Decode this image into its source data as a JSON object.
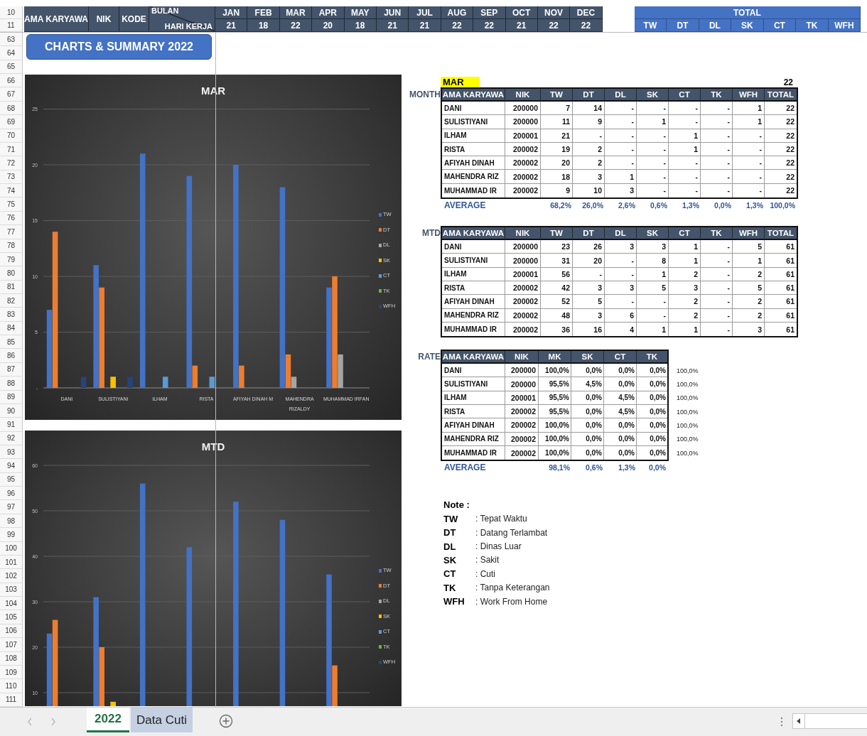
{
  "header": {
    "row_numbers": [
      "10",
      "11"
    ],
    "name_heading": "AMA KARYAWA",
    "nik_heading": "NIK",
    "kode_heading": "KODE",
    "month_heading": "BULAN",
    "workdays_heading": "HARI KERJA",
    "months": [
      {
        "name": "JAN",
        "workdays": "21"
      },
      {
        "name": "FEB",
        "workdays": "18"
      },
      {
        "name": "MAR",
        "workdays": "22"
      },
      {
        "name": "APR",
        "workdays": "20"
      },
      {
        "name": "MAY",
        "workdays": "18"
      },
      {
        "name": "JUN",
        "workdays": "21"
      },
      {
        "name": "JUL",
        "workdays": "21"
      },
      {
        "name": "AUG",
        "workdays": "22"
      },
      {
        "name": "SEP",
        "workdays": "22"
      },
      {
        "name": "OCT",
        "workdays": "21"
      },
      {
        "name": "NOV",
        "workdays": "22"
      },
      {
        "name": "DEC",
        "workdays": "22"
      }
    ],
    "total_heading": "TOTAL",
    "total_columns": [
      "TW",
      "DT",
      "DL",
      "SK",
      "CT",
      "TK",
      "WFH"
    ]
  },
  "row_numbers": [
    "63",
    "64",
    "65",
    "66",
    "67",
    "68",
    "69",
    "70",
    "71",
    "72",
    "73",
    "74",
    "75",
    "76",
    "77",
    "78",
    "79",
    "80",
    "81",
    "82",
    "83",
    "84",
    "85",
    "86",
    "87",
    "88",
    "89",
    "90",
    "91",
    "92",
    "93",
    "94",
    "95",
    "96",
    "97",
    "98",
    "99",
    "100",
    "101",
    "102",
    "103",
    "104",
    "105",
    "106",
    "107",
    "108",
    "109",
    "110",
    "111"
  ],
  "title_button": "CHARTS & SUMMARY 2022",
  "charts": [
    {
      "chart_data": {
        "type": "bar",
        "title": "MAR",
        "grid": true,
        "legend": true,
        "categories": [
          "DANI",
          "SULISTIYANI",
          "ILHAM",
          "RISTA",
          "AFIYAH DINAH M",
          "MAHENDRA RIZALDY",
          "MUHAMMAD IRFAN"
        ],
        "ylim": [
          0,
          25
        ],
        "yticks": [
          {
            "value": 0,
            "label": "-"
          },
          5,
          10,
          15,
          20,
          25
        ],
        "series": [
          {
            "name": "TW",
            "color": "#4472c4",
            "values": [
              7,
              11,
              21,
              19,
              20,
              18,
              9
            ]
          },
          {
            "name": "DT",
            "color": "#ed7d31",
            "values": [
              14,
              9,
              0,
              2,
              2,
              3,
              10
            ]
          },
          {
            "name": "DL",
            "color": "#a5a5a5",
            "values": [
              0,
              0,
              0,
              0,
              0,
              1,
              3
            ]
          },
          {
            "name": "SK",
            "color": "#ffc000",
            "values": [
              0,
              1,
              0,
              0,
              0,
              0,
              0
            ]
          },
          {
            "name": "CT",
            "color": "#5b9bd5",
            "values": [
              0,
              0,
              1,
              1,
              0,
              0,
              0
            ]
          },
          {
            "name": "TK",
            "color": "#70ad47",
            "values": [
              0,
              0,
              0,
              0,
              0,
              0,
              0
            ]
          },
          {
            "name": "WFH",
            "color": "#264478",
            "values": [
              1,
              1,
              0,
              0,
              0,
              0,
              0
            ]
          }
        ]
      }
    },
    {
      "chart_data": {
        "type": "bar",
        "title": "MTD",
        "grid": true,
        "legend": true,
        "ylim": [
          0,
          60
        ],
        "yticks": [
          10,
          20,
          30,
          40,
          50,
          60
        ],
        "series": [
          {
            "name": "TW",
            "color": "#4472c4",
            "values": [
              23,
              31,
              56,
              42,
              52,
              48,
              36
            ]
          },
          {
            "name": "DT",
            "color": "#ed7d31",
            "values": [
              26,
              20,
              null,
              null,
              null,
              null,
              16
            ]
          },
          {
            "name": "DL",
            "color": "#a5a5a5",
            "values": [
              null,
              null,
              null,
              null,
              null,
              null,
              null
            ]
          },
          {
            "name": "SK",
            "color": "#ffc000",
            "values": [
              null,
              8,
              null,
              null,
              null,
              null,
              null
            ]
          },
          {
            "name": "CT",
            "color": "#5b9bd5",
            "values": [
              null,
              null,
              null,
              null,
              null,
              null,
              null
            ]
          },
          {
            "name": "TK",
            "color": "#70ad47",
            "values": [
              null,
              null,
              null,
              null,
              null,
              null,
              null
            ]
          },
          {
            "name": "WFH",
            "color": "#264478",
            "values": [
              null,
              null,
              null,
              null,
              null,
              null,
              null
            ]
          }
        ]
      }
    }
  ],
  "month_table": {
    "month": "MAR",
    "workdays": "22",
    "label": "MONTH",
    "columns": [
      "AMA KARYAWA",
      "NIK",
      "TW",
      "DT",
      "DL",
      "SK",
      "CT",
      "TK",
      "WFH",
      "TOTAL"
    ],
    "rows": [
      {
        "cells": [
          "DANI",
          "200000",
          "7",
          "14",
          "-",
          "-",
          "-",
          "-",
          "1",
          "22"
        ]
      },
      {
        "cells": [
          "SULISTIYANI",
          "200000",
          "11",
          "9",
          "-",
          "1",
          "-",
          "-",
          "1",
          "22"
        ]
      },
      {
        "cells": [
          "ILHAM",
          "200001",
          "21",
          "-",
          "-",
          "-",
          "1",
          "-",
          "-",
          "22"
        ]
      },
      {
        "cells": [
          "RISTA",
          "200002",
          "19",
          "2",
          "-",
          "-",
          "1",
          "-",
          "-",
          "22"
        ]
      },
      {
        "cells": [
          "AFIYAH DINAH",
          "200002",
          "20",
          "2",
          "-",
          "-",
          "-",
          "-",
          "-",
          "22"
        ]
      },
      {
        "cells": [
          "MAHENDRA RIZ",
          "200002",
          "18",
          "3",
          "1",
          "-",
          "-",
          "-",
          "-",
          "22"
        ]
      },
      {
        "cells": [
          "MUHAMMAD IR",
          "200002",
          "9",
          "10",
          "3",
          "-",
          "-",
          "-",
          "-",
          "22"
        ]
      }
    ],
    "average": {
      "label": "AVERAGE",
      "values": [
        "68,2%",
        "26,0%",
        "2,6%",
        "0,6%",
        "1,3%",
        "0,0%",
        "1,3%",
        "100,0%"
      ]
    }
  },
  "mtd_table": {
    "label": "MTD",
    "columns": [
      "AMA KARYAWA",
      "NIK",
      "TW",
      "DT",
      "DL",
      "SK",
      "CT",
      "TK",
      "WFH",
      "TOTAL"
    ],
    "rows": [
      {
        "cells": [
          "DANI",
          "200000",
          "23",
          "26",
          "3",
          "3",
          "1",
          "-",
          "5",
          "61"
        ]
      },
      {
        "cells": [
          "SULISTIYANI",
          "200000",
          "31",
          "20",
          "-",
          "8",
          "1",
          "-",
          "1",
          "61"
        ]
      },
      {
        "cells": [
          "ILHAM",
          "200001",
          "56",
          "-",
          "-",
          "1",
          "2",
          "-",
          "2",
          "61"
        ]
      },
      {
        "cells": [
          "RISTA",
          "200002",
          "42",
          "3",
          "3",
          "5",
          "3",
          "-",
          "5",
          "61"
        ]
      },
      {
        "cells": [
          "AFIYAH DINAH",
          "200002",
          "52",
          "5",
          "-",
          "-",
          "2",
          "-",
          "2",
          "61"
        ]
      },
      {
        "cells": [
          "MAHENDRA RIZ",
          "200002",
          "48",
          "3",
          "6",
          "-",
          "2",
          "-",
          "2",
          "61"
        ]
      },
      {
        "cells": [
          "MUHAMMAD IR",
          "200002",
          "36",
          "16",
          "4",
          "1",
          "1",
          "-",
          "3",
          "61"
        ]
      }
    ]
  },
  "rate_table": {
    "label": "RATE",
    "columns": [
      "AMA KARYAWA",
      "NIK",
      "MK",
      "SK",
      "CT",
      "TK"
    ],
    "rows": [
      {
        "cells": [
          "DANI",
          "200000",
          "100,0%",
          "0,0%",
          "0,0%",
          "0,0%"
        ],
        "total": "100,0%"
      },
      {
        "cells": [
          "SULISTIYANI",
          "200000",
          "95,5%",
          "4,5%",
          "0,0%",
          "0,0%"
        ],
        "total": "100,0%"
      },
      {
        "cells": [
          "ILHAM",
          "200001",
          "95,5%",
          "0,0%",
          "4,5%",
          "0,0%"
        ],
        "total": "100,0%"
      },
      {
        "cells": [
          "RISTA",
          "200002",
          "95,5%",
          "0,0%",
          "4,5%",
          "0,0%"
        ],
        "total": "100,0%"
      },
      {
        "cells": [
          "AFIYAH DINAH",
          "200002",
          "100,0%",
          "0,0%",
          "0,0%",
          "0,0%"
        ],
        "total": "100,0%"
      },
      {
        "cells": [
          "MAHENDRA RIZ",
          "200002",
          "100,0%",
          "0,0%",
          "0,0%",
          "0,0%"
        ],
        "total": "100,0%"
      },
      {
        "cells": [
          "MUHAMMAD IR",
          "200002",
          "100,0%",
          "0,0%",
          "0,0%",
          "0,0%"
        ],
        "total": "100,0%"
      }
    ],
    "average": {
      "label": "AVERAGE",
      "values": [
        "98,1%",
        "0,6%",
        "1,3%",
        "0,0%"
      ]
    }
  },
  "notes": {
    "title": "Note :",
    "items": [
      {
        "code": "TW",
        "meaning": ": Tepat Waktu"
      },
      {
        "code": "DT",
        "meaning": ": Datang Terlambat"
      },
      {
        "code": "DL",
        "meaning": ": Dinas Luar"
      },
      {
        "code": "SK",
        "meaning": ": Sakit"
      },
      {
        "code": "CT",
        "meaning": ": Cuti"
      },
      {
        "code": "TK",
        "meaning": ": Tanpa Keterangan"
      },
      {
        "code": "WFH",
        "meaning": ": Work From Home"
      }
    ]
  },
  "sheet_tabs": [
    {
      "label": "2022",
      "selected": true
    },
    {
      "label": "Data Cuti",
      "selected": false
    }
  ]
}
